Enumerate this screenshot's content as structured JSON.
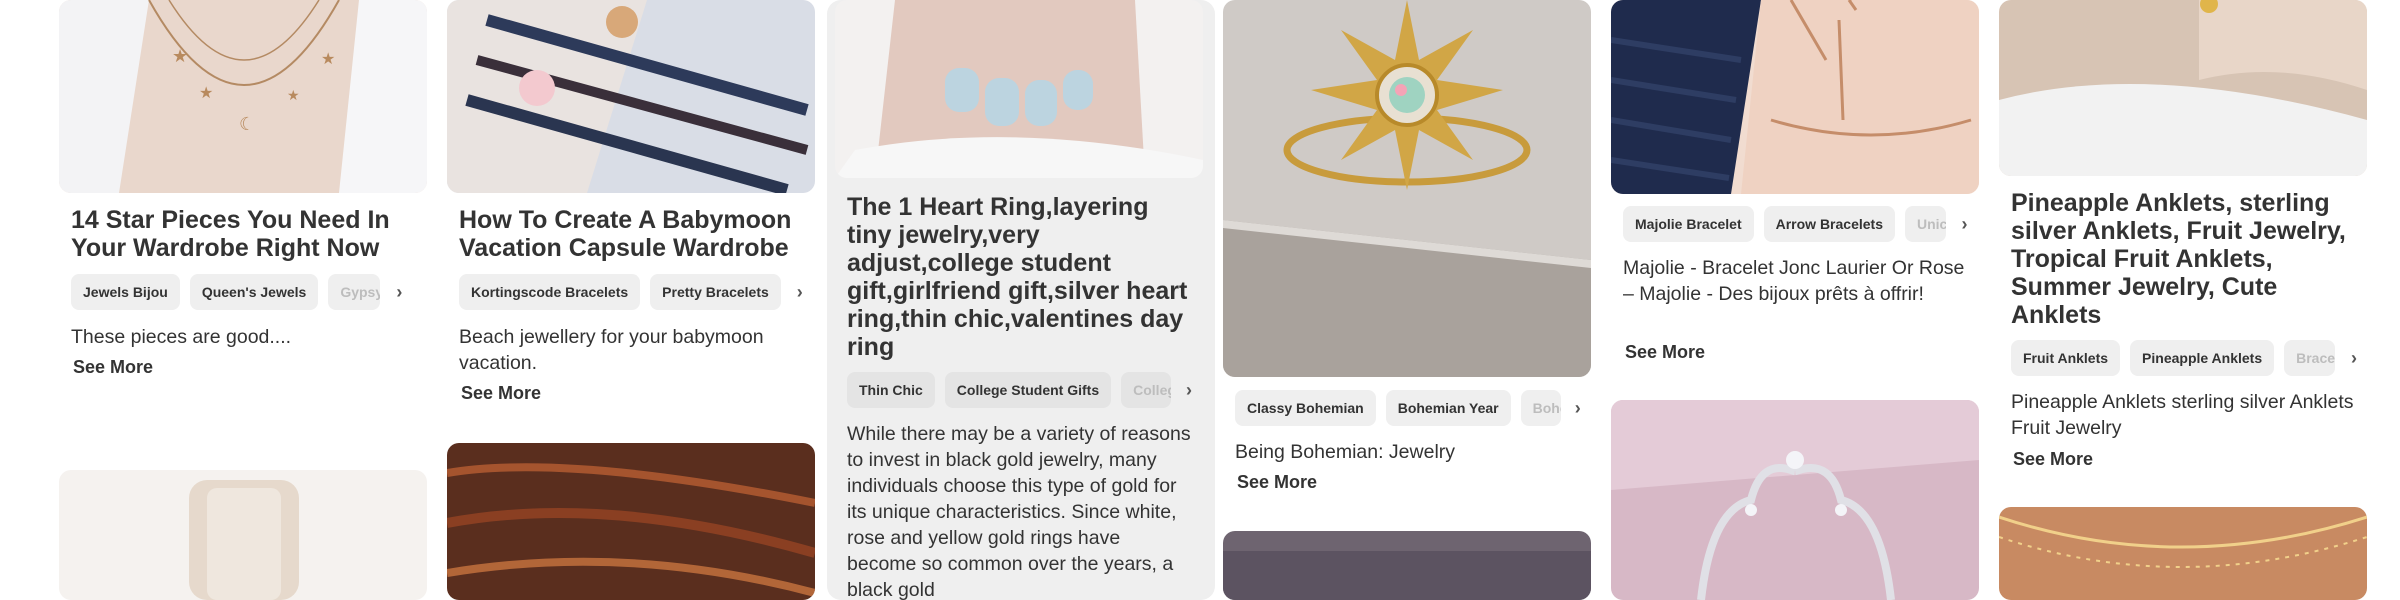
{
  "pins": [
    {
      "title": "14 Star Pieces You Need In Your Wardrobe Right Now",
      "tags": [
        "Jewels Bijou",
        "Queen's Jewels",
        "Gypsy J"
      ],
      "description": "These pieces are good....",
      "see_more": "See More"
    },
    {
      "title": "How To Create A Babymoon Vacation Capsule Wardrobe",
      "tags": [
        "Kortingscode Bracelets",
        "Pretty Bracelets"
      ],
      "description": "Beach jewellery for your babymoon vacation.",
      "see_more": "See More"
    },
    {
      "title": "The 1 Heart Ring,layering tiny jewelry,very adjust,college student gift,girlfriend gift,silver heart ring,thin chic,valentines day ring",
      "tags": [
        "Thin Chic",
        "College Student Gifts",
        "Colleg"
      ],
      "description": "While there may be a variety of reasons to invest in black gold jewelry, many individuals choose this type of gold for its unique characteristics. Since white, rose and yellow gold rings have become so common over the years, a black gold",
      "see_more": "See More"
    },
    {
      "title": "",
      "tags": [
        "Classy Bohemian",
        "Bohemian Year",
        "Bohe"
      ],
      "description": "Being Bohemian: Jewelry",
      "see_more": "See More"
    },
    {
      "title": "",
      "tags": [
        "Majolie Bracelet",
        "Arrow Bracelets",
        "Unic"
      ],
      "description": "Majolie - Bracelet Jonc Laurier Or Rose – Majolie - Des bijoux prêts à offrir!",
      "see_more": "See More"
    },
    {
      "title": "Pineapple Anklets, sterling silver Anklets, Fruit Jewelry, Tropical Fruit Anklets, Summer Jewelry, Cute Anklets",
      "tags": [
        "Fruit Anklets",
        "Pineapple Anklets",
        "Brace"
      ],
      "description": "Pineapple Anklets sterling silver Anklets Fruit Jewelry",
      "see_more": "See More"
    }
  ],
  "icons": {
    "tag_scroll": "chevron-right-icon"
  }
}
